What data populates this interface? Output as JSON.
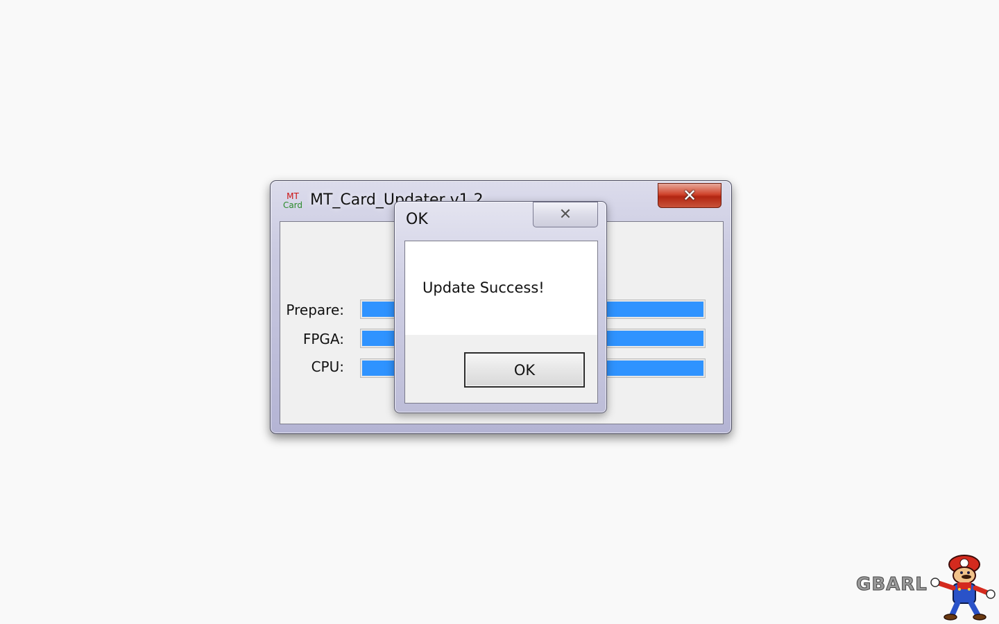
{
  "main_window": {
    "icon_line1": "MT",
    "icon_line2": "Card",
    "title": "MT_Card_Updater v1.2",
    "close_glyph": "✕",
    "progress_rows": [
      {
        "label": "Prepare:",
        "progress": 1.0
      },
      {
        "label": "FPGA:",
        "progress": 1.0
      },
      {
        "label": "CPU:",
        "progress": 1.0
      }
    ]
  },
  "dialog": {
    "title": "OK",
    "close_glyph": "✕",
    "message": "Update Success!",
    "ok_label": "OK"
  },
  "watermark": {
    "text": "GBARL",
    "mascot_icon": "mario-mascot-icon"
  },
  "colors": {
    "progress_fill": "#2f93ff",
    "close_red": "#c8331c"
  }
}
